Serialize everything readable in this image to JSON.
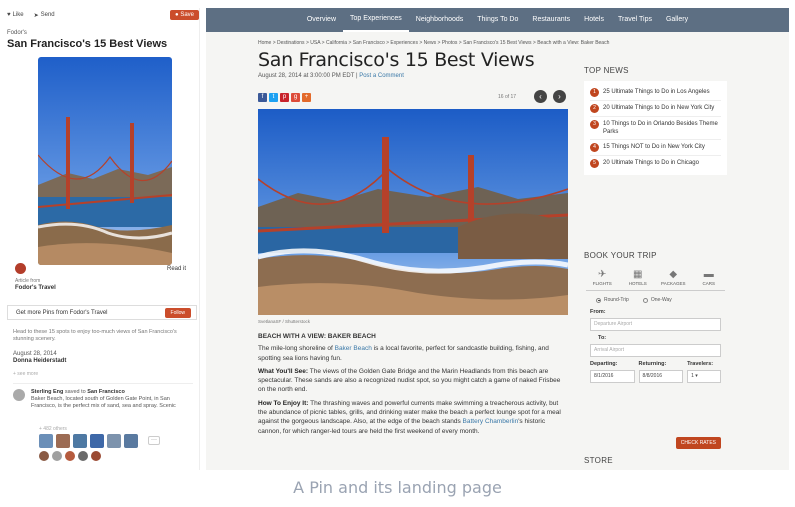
{
  "pin": {
    "like": "Like",
    "send": "Send",
    "save": "Save",
    "brand": "Fodor's",
    "title": "San Francisco's 15 Best Views",
    "read_it": "Read it",
    "pinned_from_label": "Article from",
    "pinned_from": "Fodor's Travel",
    "follow_prompt": "Get more Pins from Fodor's Travel",
    "follow_button": "Follow",
    "description": "Head to these 15 spots to enjoy too-much views of San Francisco's stunning scenery.",
    "date": "August 28, 2014",
    "author": "Donna Heiderstadt",
    "see_more": "+ see more",
    "saver_name": "Sterling Eng",
    "saver_action": "saved to",
    "saver_board": "San Francisco",
    "saver_note": "Baker Beach, located south of Golden Gate Point, in San Francisco, is the perfect mix of sand, sea and spray. Scenic",
    "thumbs_label": "+ 482 others",
    "more": "···"
  },
  "site": {
    "nav": [
      "Overview",
      "Top Experiences",
      "Neighborhoods",
      "Things To Do",
      "Restaurants",
      "Hotels",
      "Travel Tips",
      "Gallery"
    ],
    "active_nav": "Top Experiences",
    "breadcrumb": "Home > Destinations > USA > California > San Francisco > Experiences > News > Photos > San Francisco's 15 Best Views > Beach with a View: Baker Beach",
    "title": "San Francisco's 15 Best Views",
    "date": "August 28, 2014 at 3:00:00 PM EDT",
    "post_comment": "Post a Comment",
    "counter": "16 of 17",
    "prev": "‹",
    "next": "›",
    "photo_credit": "SvetlanaSF / Shutterstock",
    "section_heading": "BEACH WITH A VIEW: BAKER BEACH",
    "para1_a": "The mile-long shoreline of ",
    "para1_link": "Baker Beach",
    "para1_b": " is a local favorite, perfect for sandcastle building, fishing, and spotting sea lions having fun.",
    "para2_label": "What You'll See:",
    "para2": " The views of the Golden Gate Bridge and the Marin Headlands from this beach are spectacular. These sands are also a recognized nudist spot, so you might catch a game of naked Frisbee on the north end.",
    "para3_label": "How To Enjoy It:",
    "para3_a": " The thrashing waves and powerful currents make swimming a treacherous activity, but the abundance of picnic tables, grills, and drinking water make the beach a perfect lounge spot for a meal against the gorgeous landscape. Also, at the edge of the beach stands ",
    "para3_link": "Battery Chamberlin",
    "para3_b": "'s historic cannon, for which ranger-led tours are held the first weekend of every month."
  },
  "top_news": {
    "heading": "TOP NEWS",
    "items": [
      {
        "num": "1",
        "text": "25 Ultimate Things to Do in Los Angeles"
      },
      {
        "num": "2",
        "text": "20 Ultimate Things to Do in New York City"
      },
      {
        "num": "3",
        "text": "10 Things to Do in Orlando Besides Theme Parks"
      },
      {
        "num": "4",
        "text": "15 Things NOT to Do in New York City"
      },
      {
        "num": "5",
        "text": "20 Ultimate Things to Do in Chicago"
      }
    ]
  },
  "book": {
    "heading": "BOOK YOUR TRIP",
    "modes": [
      "FLIGHTS",
      "HOTELS",
      "PACKAGES",
      "CARS"
    ],
    "round_trip": "Round-Trip",
    "one_way": "One-Way",
    "from_label": "From:",
    "from_placeholder": "Departure Airport",
    "to_label": "To:",
    "to_placeholder": "Arrival Airport",
    "departing_label": "Departing:",
    "departing": "8/1/2016",
    "returning_label": "Returning:",
    "returning": "8/8/2016",
    "travelers_label": "Travelers:",
    "travelers": "1",
    "check_rates": "CHECK RATES",
    "store_heading": "STORE"
  },
  "caption": "A Pin and its landing page",
  "colors": {
    "nav": "#5d6f83",
    "accent": "#c0461f",
    "pinterest_red": "#cb4d2b"
  }
}
